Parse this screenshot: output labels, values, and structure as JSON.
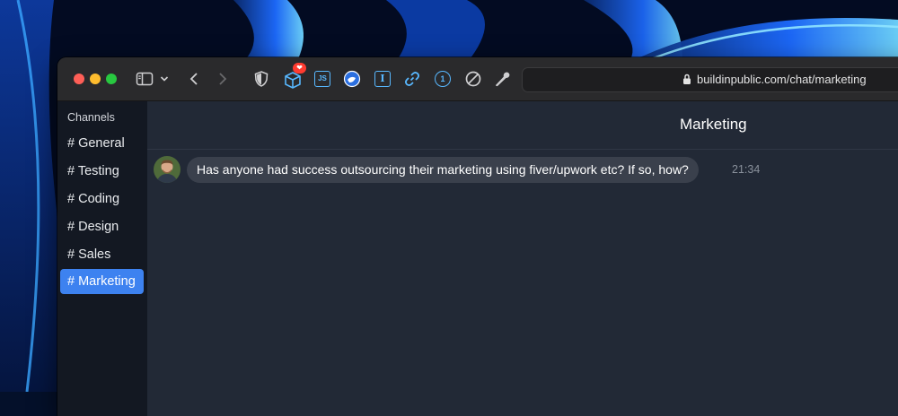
{
  "browser": {
    "url": "buildinpublic.com/chat/marketing",
    "extensions": {
      "badge_glyph": "❤",
      "js_label": "JS",
      "i_label": "I",
      "onepassword_label": "1"
    }
  },
  "sidebar": {
    "heading": "Channels",
    "channels": [
      {
        "label": "# General"
      },
      {
        "label": "# Testing"
      },
      {
        "label": "# Coding"
      },
      {
        "label": "# Design"
      },
      {
        "label": "# Sales"
      },
      {
        "label": "# Marketing",
        "active": true
      }
    ]
  },
  "chat": {
    "title": "Marketing",
    "messages": [
      {
        "text": "Has anyone had success outsourcing their marketing using fiver/upwork etc? If so, how?",
        "time": "21:34"
      }
    ]
  },
  "colors": {
    "accent": "#3d82f0",
    "sidebar_bg": "#131822",
    "main_bg": "#222936",
    "bubble_bg": "#3a404c"
  }
}
